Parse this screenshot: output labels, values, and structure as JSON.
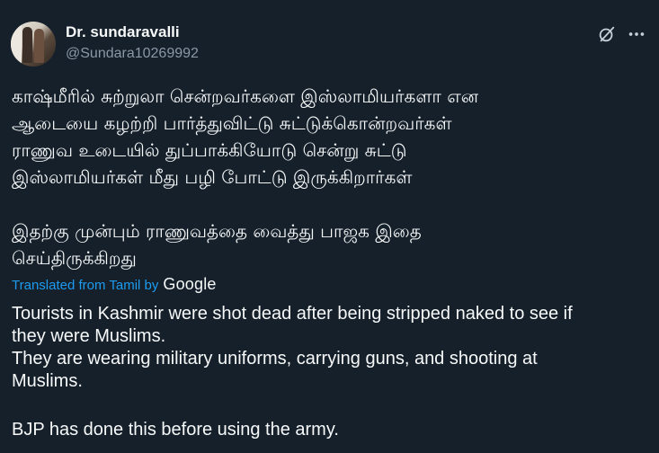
{
  "author": {
    "display_name": "Dr. sundaravalli",
    "handle": "@Sundara10269992"
  },
  "icons": {
    "grok": "grok-icon",
    "more": "more-icon",
    "avatar": "avatar"
  },
  "tweet": {
    "tamil_lines": [
      "காஷ்மீரில் சுற்றுலா சென்றவர்களை இஸ்லாமியர்களா என",
      "ஆடையை கழற்றி பார்த்துவிட்டு  சுட்டுக்கொன்றவர்கள்",
      "ராணுவ உடையில் துப்பாக்கியோடு சென்று சுட்டு",
      "இஸ்லாமியர்கள் மீது பழி போட்டு இருக்கிறார்கள்",
      "இதற்கு முன்பும் ராணுவத்தை வைத்து பாஜக இதை",
      "செய்திருக்கிறது"
    ],
    "translated_label": "Translated from Tamil by",
    "translator": "Google",
    "english_lines": [
      "Tourists in Kashmir were shot dead after being stripped naked to see if",
      "they were Muslims.",
      "They are wearing military uniforms, carrying guns, and shooting at",
      "Muslims.",
      "BJP has done this before using the army."
    ]
  },
  "colors": {
    "background": "#15202b",
    "text": "#f7f9f9",
    "secondary": "#8b98a5",
    "link": "#1d9bf0"
  }
}
